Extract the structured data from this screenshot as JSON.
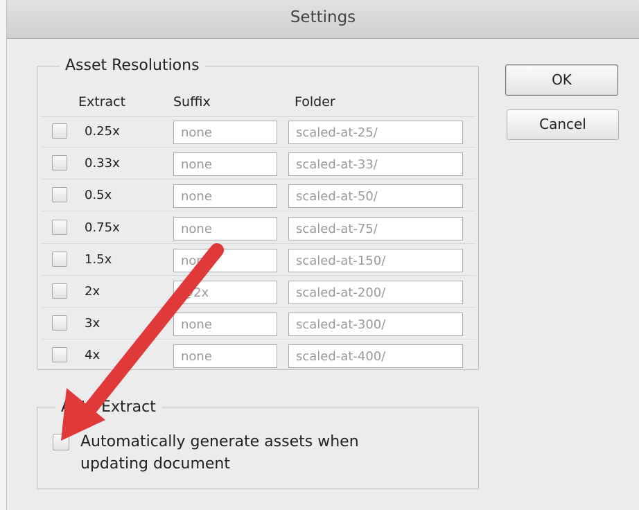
{
  "window": {
    "title": "Settings"
  },
  "asset_resolutions": {
    "label": "Asset Resolutions",
    "headers": {
      "extract": "Extract",
      "suffix": "Suffix",
      "folder": "Folder"
    },
    "rows": [
      {
        "label": "0.25x",
        "suffix": "none",
        "folder": "scaled-at-25/",
        "checked": false
      },
      {
        "label": "0.33x",
        "suffix": "none",
        "folder": "scaled-at-33/",
        "checked": false
      },
      {
        "label": "0.5x",
        "suffix": "none",
        "folder": "scaled-at-50/",
        "checked": false
      },
      {
        "label": "0.75x",
        "suffix": "none",
        "folder": "scaled-at-75/",
        "checked": false
      },
      {
        "label": "1.5x",
        "suffix": "none",
        "folder": "scaled-at-150/",
        "checked": false
      },
      {
        "label": "2x",
        "suffix": "@2x",
        "folder": "scaled-at-200/",
        "checked": false
      },
      {
        "label": "3x",
        "suffix": "none",
        "folder": "scaled-at-300/",
        "checked": false
      },
      {
        "label": "4x",
        "suffix": "none",
        "folder": "scaled-at-400/",
        "checked": false
      }
    ]
  },
  "auto_extract": {
    "label": "Auto Extract",
    "option_label": "Automatically generate assets when updating document",
    "checked": false
  },
  "buttons": {
    "ok": "OK",
    "cancel": "Cancel"
  },
  "annotation": {
    "arrow_color": "#e0393a"
  }
}
